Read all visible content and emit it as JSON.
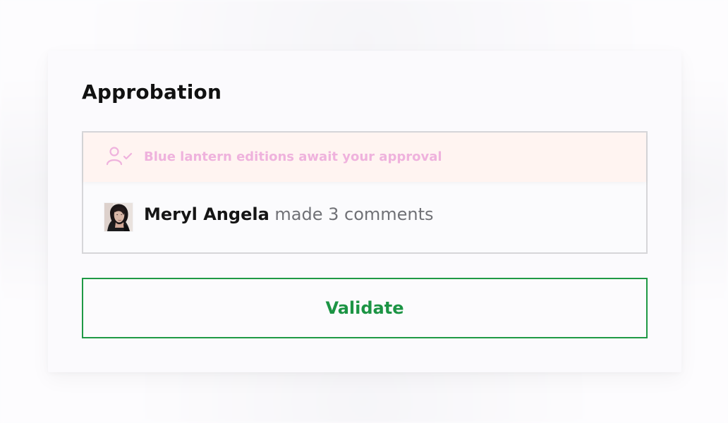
{
  "panel": {
    "title": "Approbation"
  },
  "notice": {
    "icon": "user-check-icon",
    "message": "Blue lantern editions await your approval"
  },
  "comment": {
    "name": "Meryl Angela",
    "action": " made 3 comments",
    "avatar_icon": "avatar"
  },
  "actions": {
    "validate_label": "Validate"
  },
  "colors": {
    "accent_pink": "#efb2dd",
    "accent_green": "#1f9945",
    "notice_bg": "#fff4f1"
  }
}
